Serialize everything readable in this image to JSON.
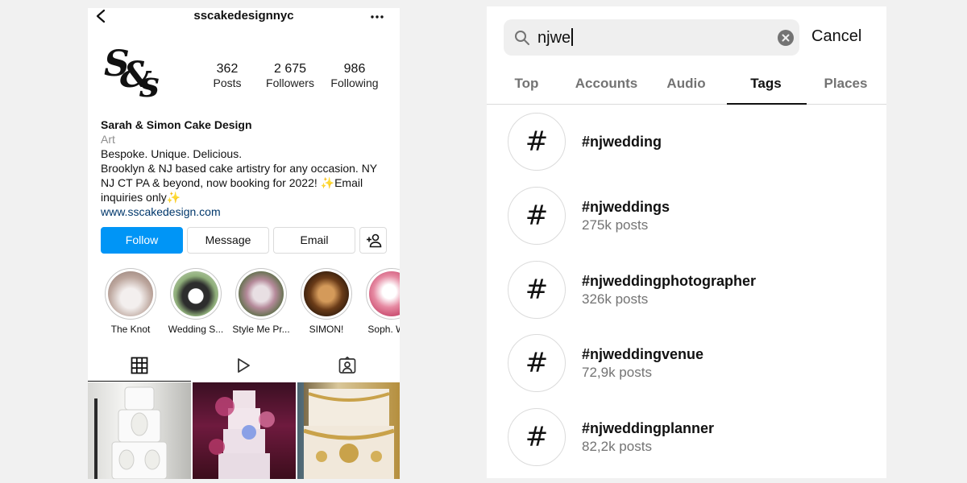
{
  "profile": {
    "username": "sscakedesignnyc",
    "logo_text": {
      "first": "S",
      "amp": "&",
      "second": "s"
    },
    "stats": [
      {
        "value": "362",
        "label": "Posts"
      },
      {
        "value": "2 675",
        "label": "Followers"
      },
      {
        "value": "986",
        "label": "Following"
      }
    ],
    "bio": {
      "name": "Sarah & Simon Cake Design",
      "category": "Art",
      "line1": "Bespoke. Unique. Delicious.",
      "line2": "Brooklyn & NJ based cake artistry for any occasion. NY",
      "line3": "NJ CT PA & beyond, now booking for 2022! ",
      "line3_end": "Email",
      "line4": "inquiries only",
      "sparkle": "✨",
      "link": "www.sscakedesign.com"
    },
    "buttons": {
      "follow": "Follow",
      "message": "Message",
      "email": "Email"
    },
    "highlights": [
      {
        "label": "The Knot",
        "color": "#c9b8b0"
      },
      {
        "label": "Wedding S...",
        "color": "#8fae7a"
      },
      {
        "label": "Style Me Pr...",
        "color": "#9a8a7a"
      },
      {
        "label": "SIMON!",
        "color": "#5a3a20"
      },
      {
        "label": "Soph. Wed",
        "color": "#d96b86"
      }
    ],
    "accent_color": "#0095f6"
  },
  "search": {
    "query": "njwe",
    "cancel_label": "Cancel",
    "tabs": [
      "Top",
      "Accounts",
      "Audio",
      "Tags",
      "Places"
    ],
    "active_tab": "Tags",
    "results": [
      {
        "tag": "#njwedding",
        "posts": ""
      },
      {
        "tag": "#njweddings",
        "posts": "275k posts"
      },
      {
        "tag": "#njweddingphotographer",
        "posts": "326k posts"
      },
      {
        "tag": "#njweddingvenue",
        "posts": "72,9k posts"
      },
      {
        "tag": "#njweddingplanner",
        "posts": "82,2k posts"
      }
    ],
    "hash_symbol": "#"
  }
}
